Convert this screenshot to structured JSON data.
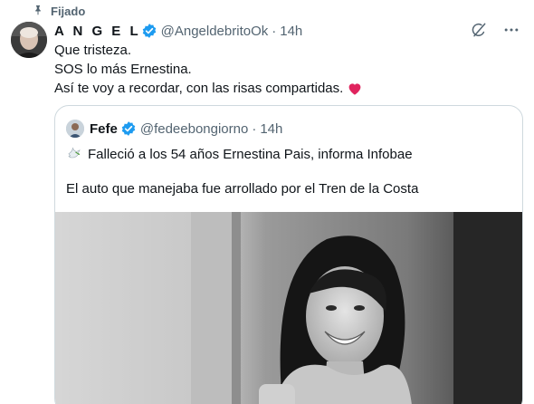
{
  "pinned_label": "Fijado",
  "tweet": {
    "display_name": "A N G E L",
    "handle": "@AngeldebritoOk",
    "separator": "·",
    "time": "14h",
    "lines": [
      "Que tristeza.",
      "SOS lo más Ernestina.",
      "Así te voy a recordar, con las risas compartidas."
    ]
  },
  "quote": {
    "display_name": "Fefe",
    "handle": "@fedeebongiorno",
    "separator": "·",
    "time": "14h",
    "headline": "Falleció a los 54 años Ernestina Pais, informa Infobae",
    "body": "El auto que manejaba fue arrollado por el Tren de la Costa"
  },
  "icons": {
    "pin": "pin-icon",
    "verified": "verified-badge-icon",
    "grok": "grok-icon",
    "more": "more-icon",
    "heart": "red-heart-emoji",
    "dove": "dove-emoji"
  },
  "colors": {
    "text": "#0f1419",
    "secondary": "#536471",
    "verified_blue": "#1d9bf0",
    "border": "#cfd9de",
    "heart_red": "#e0245e"
  }
}
